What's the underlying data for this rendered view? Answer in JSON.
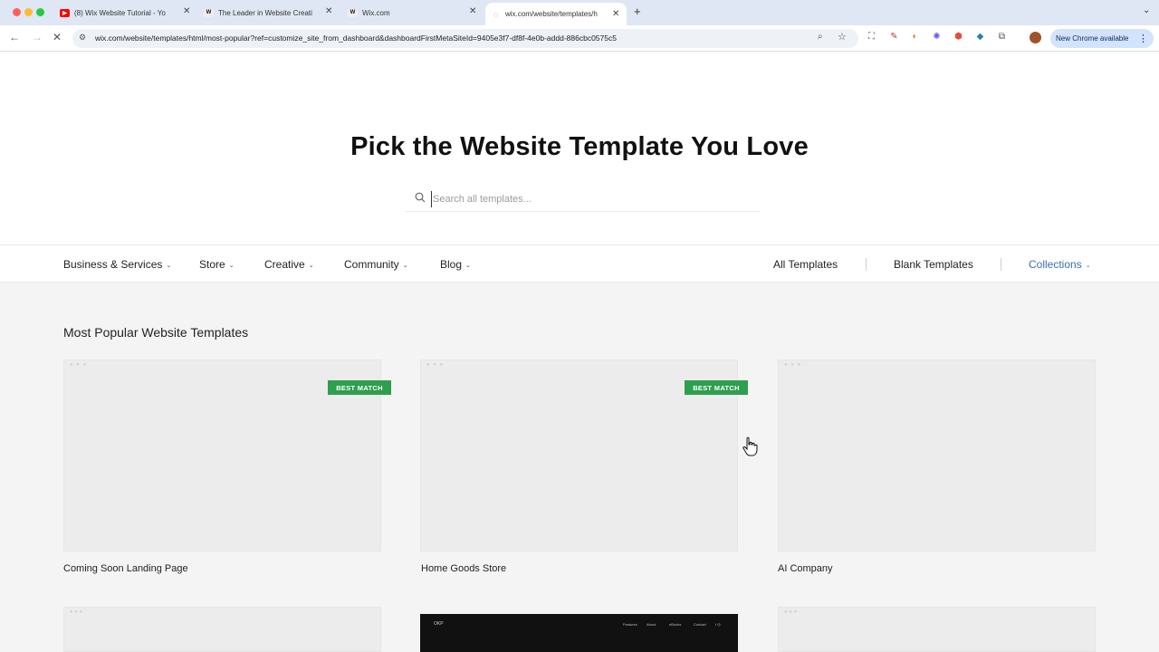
{
  "browser": {
    "tabs": [
      {
        "title": "(8) Wix Website Tutorial - Yo",
        "favicon": "youtube-icon"
      },
      {
        "title": "The Leader in Website Creati",
        "favicon": "wix-icon"
      },
      {
        "title": "Wix.com",
        "favicon": "wix-icon"
      },
      {
        "title": "wix.com/website/templates/h",
        "favicon": "loading-icon"
      }
    ],
    "new_tab": "+",
    "url": "wix.com/website/templates/html/most-popular?ref=customize_site_from_dashboard&dashboardFirstMetaSiteId=9405e3f7-df8f-4e0b-addd-886cbc0575c5",
    "update_label": "New Chrome available"
  },
  "hero": {
    "title": "Pick the Website Template You Love",
    "search_placeholder": "Search all templates..."
  },
  "categories": {
    "left": [
      {
        "label": "Business & Services"
      },
      {
        "label": "Store"
      },
      {
        "label": "Creative"
      },
      {
        "label": "Community"
      },
      {
        "label": "Blog"
      }
    ],
    "all_templates": "All Templates",
    "blank_templates": "Blank Templates",
    "collections": "Collections"
  },
  "section": {
    "title": "Most Popular Website Templates"
  },
  "templates": [
    {
      "name": "Coming Soon Landing Page",
      "badge": "BEST MATCH"
    },
    {
      "name": "Home Goods Store",
      "badge": "BEST MATCH"
    },
    {
      "name": "AI Company",
      "badge": ""
    }
  ],
  "preview": {
    "logo": "OKP",
    "menu": [
      "Features",
      "About",
      "eBooks",
      "Contact",
      "f ◎"
    ]
  },
  "colors": {
    "badge": "#2e9e4f",
    "collections": "#3b6fb6",
    "tab_strip": "#dfe7f5"
  }
}
